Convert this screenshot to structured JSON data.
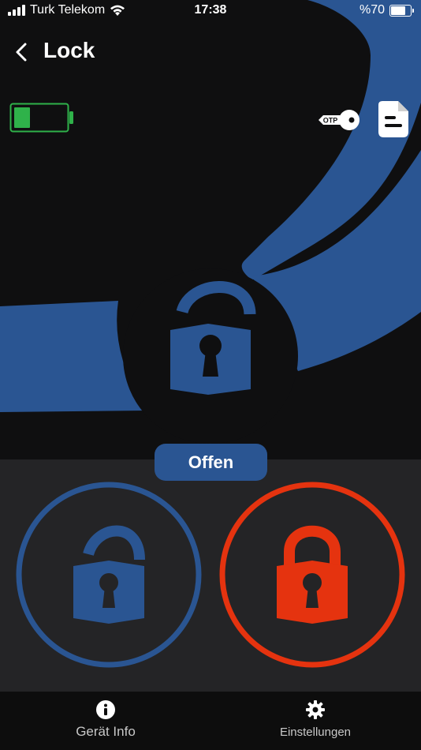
{
  "status_bar": {
    "carrier": "Turk Telekom",
    "time": "17:38",
    "battery_text": "%70",
    "battery_level": 0.7
  },
  "nav": {
    "title": "Lock",
    "back_icon": "chevron-left-icon"
  },
  "device": {
    "battery_level": 0.3,
    "battery_color": "#2fb24a"
  },
  "toolbar": {
    "otp_label": "OTP",
    "otp_icon": "otp-key-icon",
    "log_icon": "document-icon"
  },
  "lock": {
    "state_label": "Offen",
    "center_icon": "padlock-open-icon"
  },
  "actions": {
    "open_icon": "padlock-open-icon",
    "close_icon": "padlock-closed-icon"
  },
  "tabbar": {
    "info_label": "Gerät Info",
    "info_icon": "info-icon",
    "settings_label": "Einstellungen",
    "settings_icon": "gear-icon"
  },
  "colors": {
    "accent_blue": "#2a5592",
    "lock_red": "#e5330f",
    "background": "#0f0f10",
    "panel": "#242426"
  }
}
